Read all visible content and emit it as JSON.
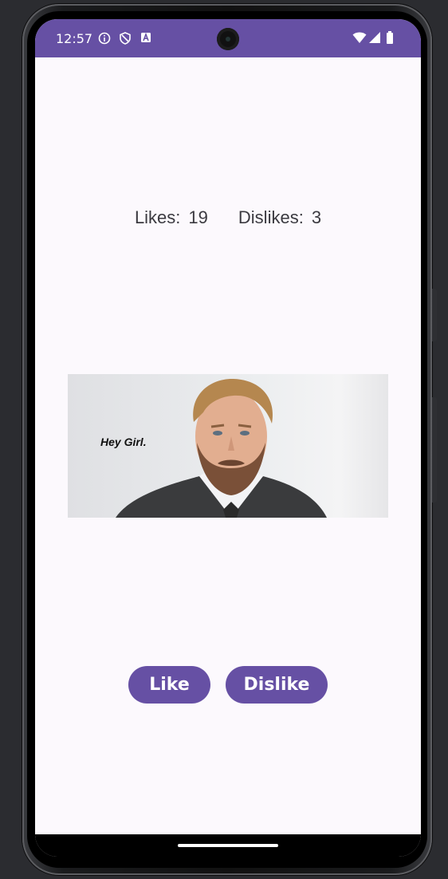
{
  "status_bar": {
    "time": "12:57",
    "icons": [
      "info-icon",
      "shield-icon",
      "accessibility-icon",
      "wifi-icon",
      "signal-icon",
      "battery-icon"
    ]
  },
  "counts": {
    "likes_label": "Likes:",
    "likes_value": "19",
    "dislikes_label": "Dislikes:",
    "dislikes_value": "3"
  },
  "image": {
    "caption": "Hey Girl."
  },
  "buttons": {
    "like": "Like",
    "dislike": "Dislike"
  },
  "colors": {
    "primary": "#6650a4",
    "background": "#fcf9fd",
    "text": "#3b3a40"
  }
}
